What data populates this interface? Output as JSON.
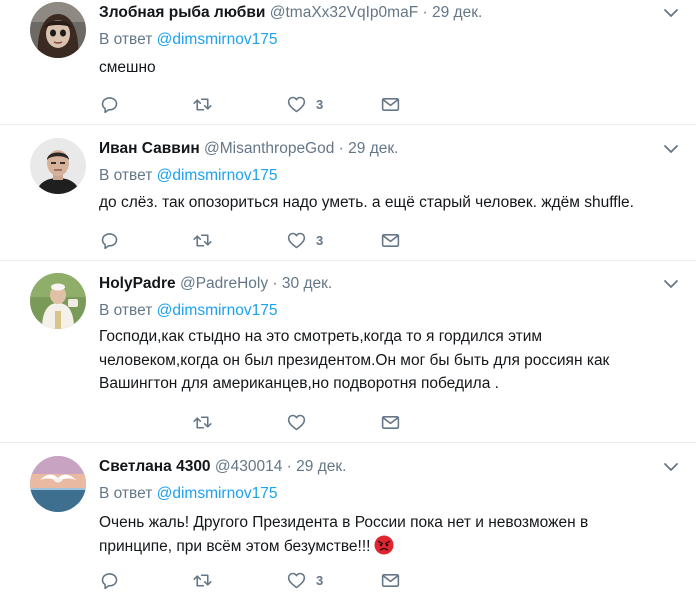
{
  "labels": {
    "reply_prefix": "В ответ",
    "separator": "·"
  },
  "colors": {
    "link": "#1da1f2",
    "secondary_text": "#657786",
    "primary_text": "#14171a",
    "divider": "#e6ecf0",
    "angry_emoji": "#e0252f"
  },
  "tweets": [
    {
      "name": "Злобная рыба любви",
      "handle": "@tmaXx32VqIp0maF",
      "date": "29 дек.",
      "reply_to": "@dimsmirnov175",
      "text": "смешно",
      "likes": "3",
      "avatar_icon": "avatar-anime-girl"
    },
    {
      "name": "Иван Саввин",
      "handle": "@MisanthropeGod",
      "date": "29 дек.",
      "reply_to": "@dimsmirnov175",
      "text": "до слёз. так опозориться надо уметь. а ещё старый человек.  ждём shuffle.",
      "likes": "3",
      "avatar_icon": "avatar-man"
    },
    {
      "name": "HolyPadre",
      "handle": "@PadreHoly",
      "date": "30 дек.",
      "reply_to": "@dimsmirnov175",
      "text": "Господи,как стыдно на это смотреть,когда то я гордился этим человеком,когда он был президентом.Он мог бы быть для россиян как Вашингтон для американцев,но подворотня победила .",
      "likes": "",
      "avatar_icon": "avatar-pope"
    },
    {
      "name": "Светлана 4300",
      "handle": "@430014",
      "date": "29 дек.",
      "reply_to": "@dimsmirnov175",
      "text": "Очень жаль! Другого Президента в России пока нет и невозможен в принципе, при всём этом безумстве!!!",
      "likes": "3",
      "avatar_icon": "avatar-seagull",
      "emoji": "angry-face-icon"
    }
  ]
}
